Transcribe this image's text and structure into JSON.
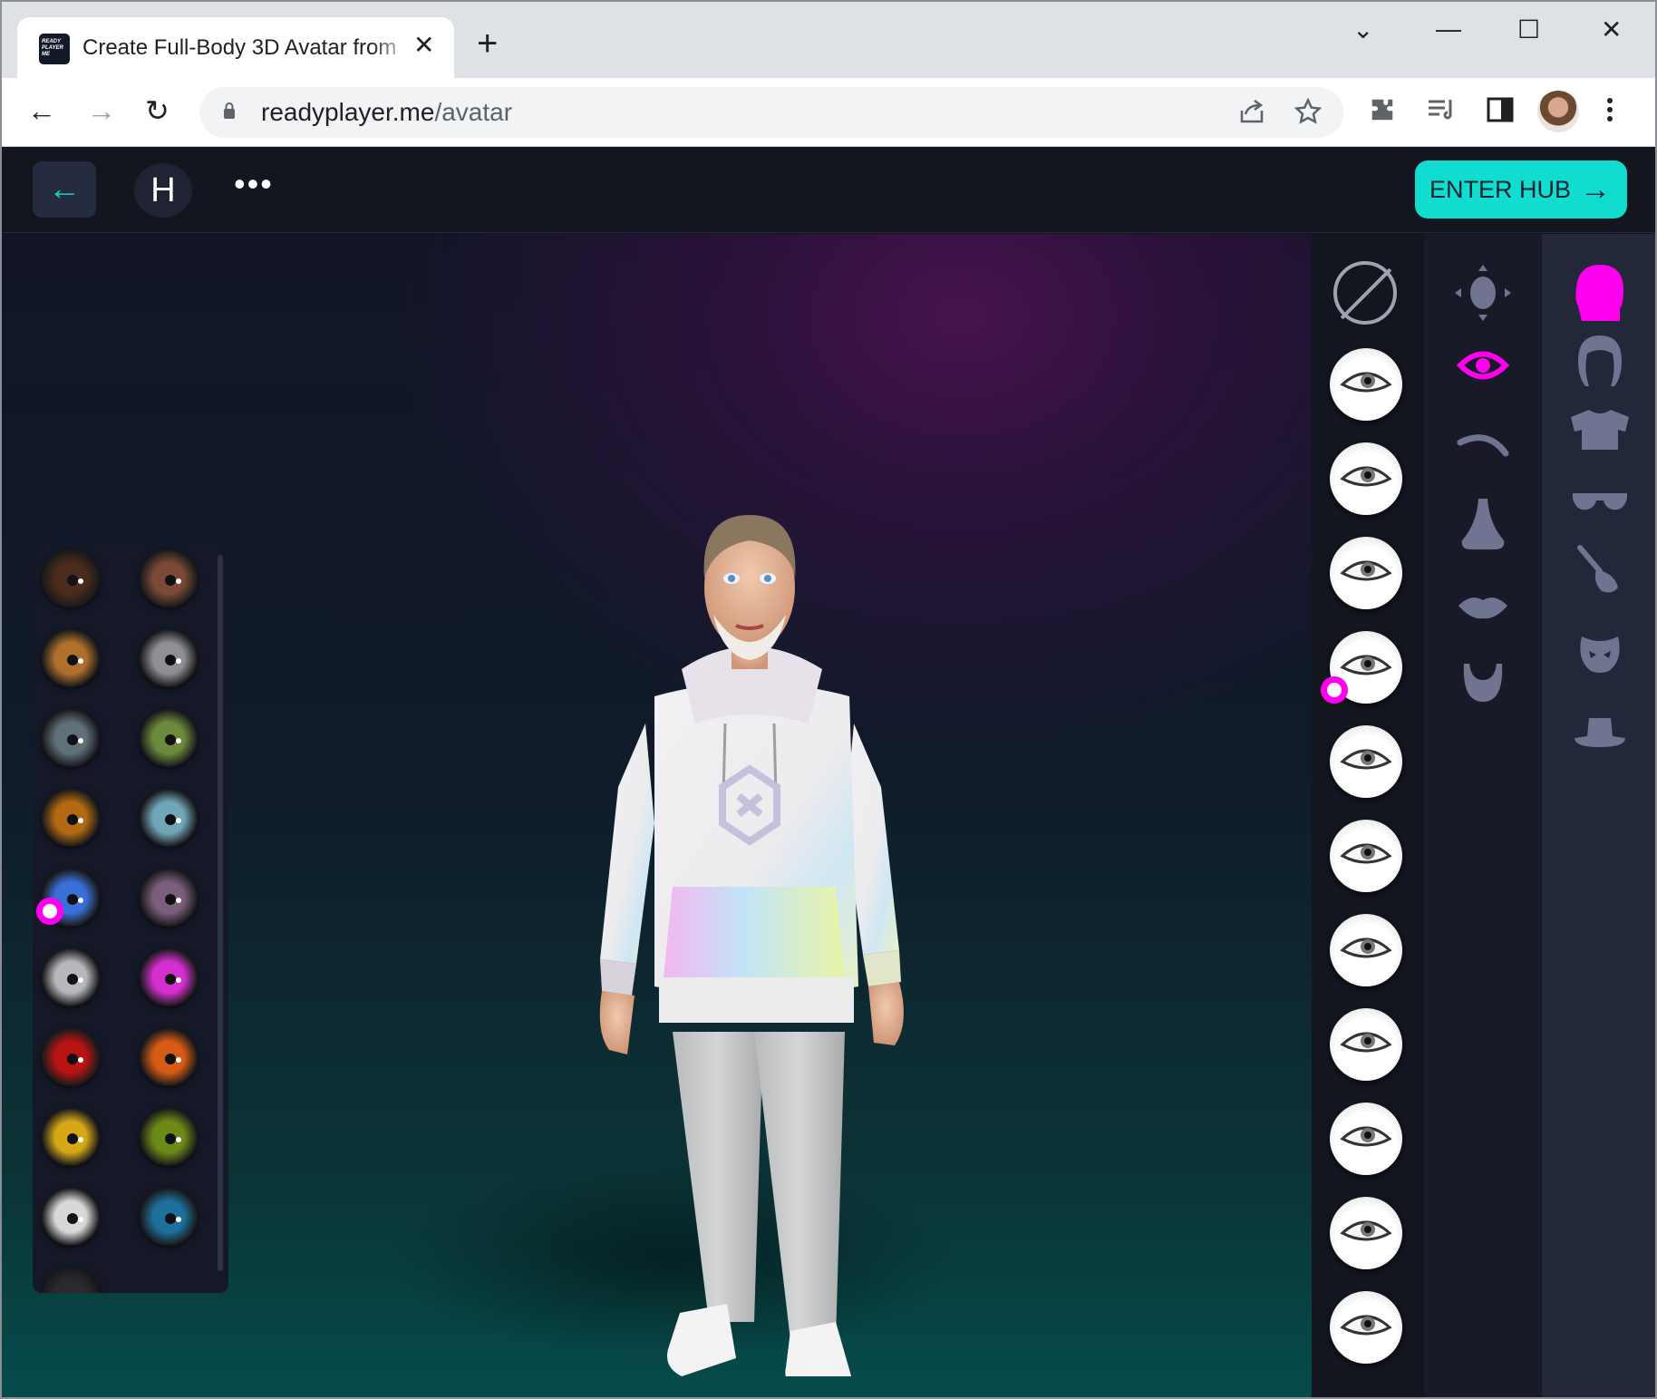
{
  "browser": {
    "tab_title": "Create Full-Body 3D Avatar from",
    "tab_close": "✕",
    "new_tab": "+",
    "favicon_text": "READY PLAYER ME",
    "url_domain": "readyplayer.me",
    "url_path": "/avatar",
    "nav_back": "←",
    "nav_forward": "→",
    "nav_reload": "↻",
    "win_dropdown": "⌄",
    "win_minimize": "—",
    "win_maximize": "☐",
    "win_close": "✕"
  },
  "app": {
    "back_arrow": "←",
    "user_initial": "H",
    "more": "•••",
    "enter_hub_label": "ENTER HUB",
    "enter_hub_arrow": "→"
  },
  "colors": {
    "accent": "#10dcd0",
    "selected": "#ff00ee",
    "icon_inactive": "#6f7590"
  },
  "iris_swatches": [
    {
      "color": "#4a2b1d",
      "selected": false
    },
    {
      "color": "#7a4a36",
      "selected": false
    },
    {
      "color": "#b0702c",
      "selected": false
    },
    {
      "color": "#8f8f94",
      "selected": false
    },
    {
      "color": "#5f7079",
      "selected": false
    },
    {
      "color": "#6c8a3c",
      "selected": false
    },
    {
      "color": "#b36a12",
      "selected": false
    },
    {
      "color": "#6fa6b8",
      "selected": false
    },
    {
      "color": "#3a6fd8",
      "selected": true
    },
    {
      "color": "#7b5d7c",
      "selected": false
    },
    {
      "color": "#b8b8bc",
      "selected": false
    },
    {
      "color": "#d62fd0",
      "selected": false
    },
    {
      "color": "#b81414",
      "selected": false
    },
    {
      "color": "#d75b14",
      "selected": false
    },
    {
      "color": "#d6a818",
      "selected": false
    },
    {
      "color": "#6c8a16",
      "selected": false
    },
    {
      "color": "#d8d8da",
      "selected": false
    },
    {
      "color": "#1d6f9c",
      "selected": false
    },
    {
      "color": "#2a2a2e",
      "selected": false
    }
  ],
  "eye_shapes": {
    "count": 11,
    "selected_index": 3
  },
  "face_tools": [
    "face-move-icon",
    "eye-icon",
    "eyebrow-icon",
    "nose-icon",
    "lips-icon",
    "beard-icon"
  ],
  "face_tools_selected": "eye-icon",
  "categories": [
    "head-icon",
    "hair-icon",
    "shirt-icon",
    "glasses-icon",
    "makeup-brush-icon",
    "mask-icon",
    "hat-icon"
  ],
  "category_selected": "head-icon"
}
